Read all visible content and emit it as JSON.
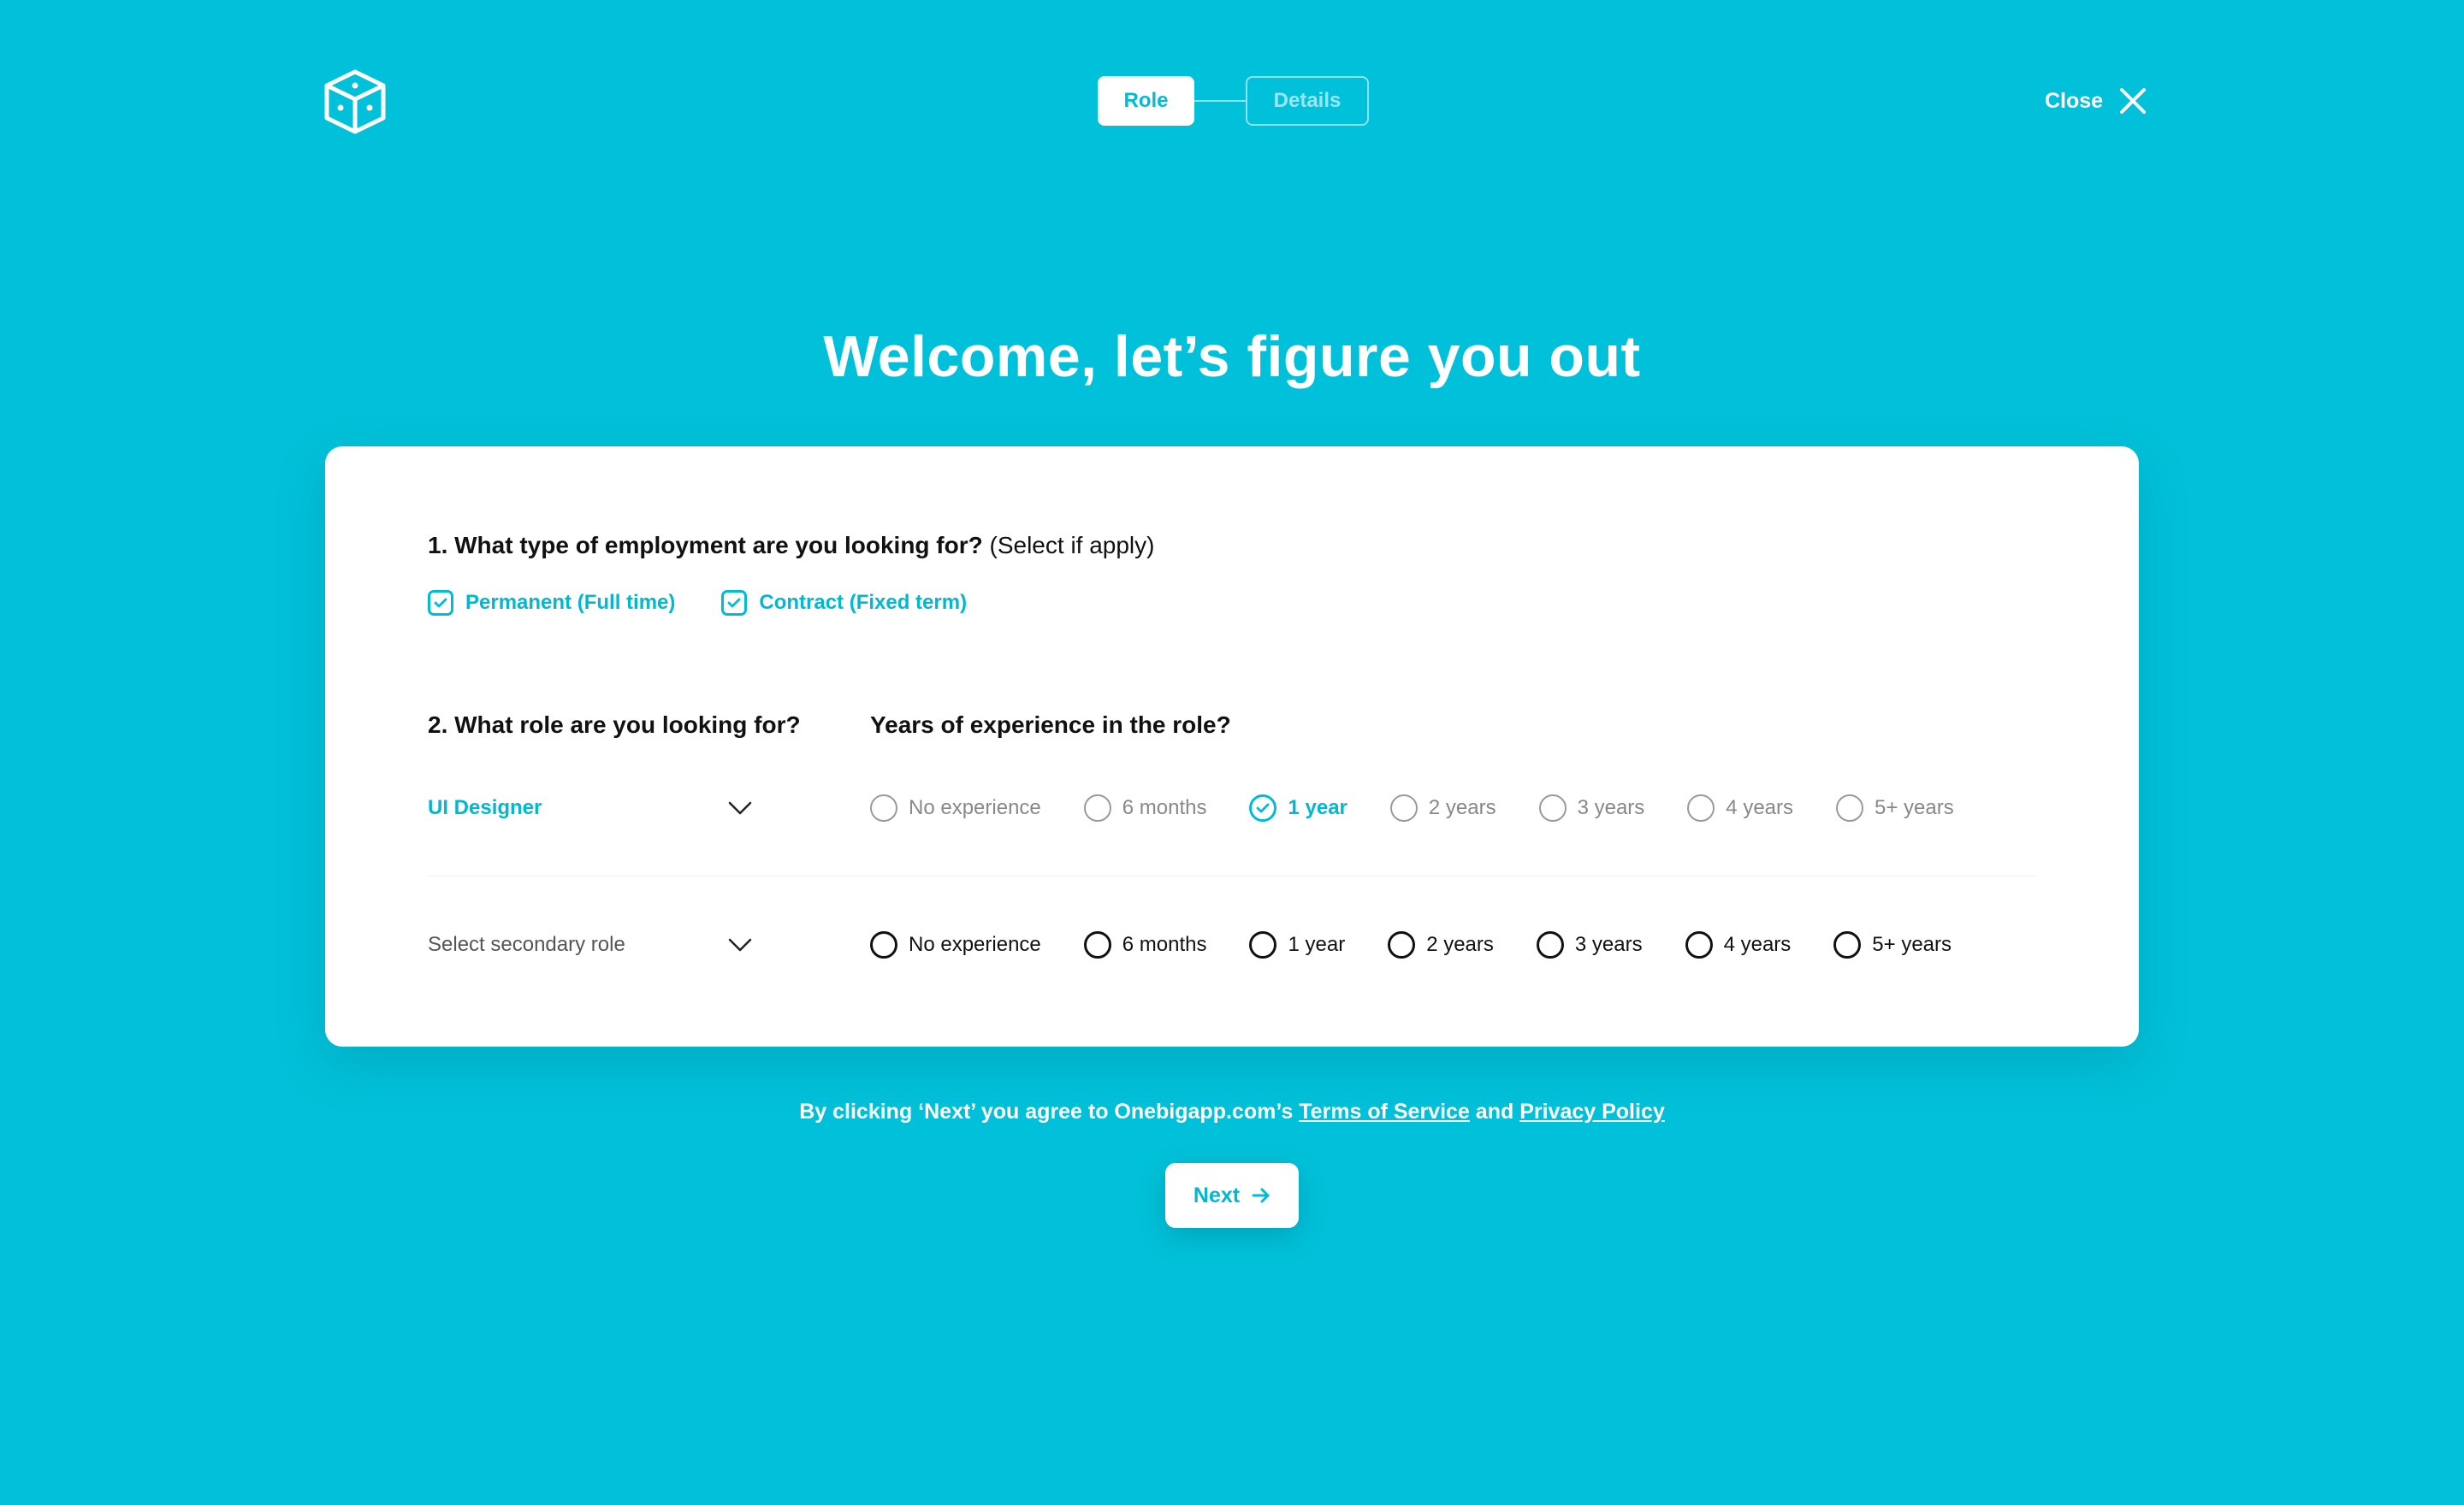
{
  "header": {
    "steps": [
      {
        "label": "Role",
        "active": true
      },
      {
        "label": "Details",
        "active": false
      }
    ],
    "close_label": "Close"
  },
  "headline": "Welcome, let’s figure you out",
  "form": {
    "q1": {
      "title": "1. What type of employment are you looking for?",
      "hint": "(Select if apply)",
      "options": [
        {
          "label": "Permanent (Full time)",
          "checked": true
        },
        {
          "label": "Contract (Fixed term)",
          "checked": true
        }
      ]
    },
    "q2": {
      "title": "2. What role are you looking for?",
      "primary_role": "UI Designer",
      "secondary_role_placeholder": "Select secondary role"
    },
    "q3": {
      "title": "Years of experience in the role?",
      "options": [
        "No experience",
        "6 months",
        "1 year",
        "2 years",
        "3 years",
        "4 years",
        "5+ years"
      ],
      "primary_selected": "1 year",
      "secondary_selected": null
    }
  },
  "footer": {
    "terms_prefix": "By clicking ‘Next’ you agree to Onebigapp.com’s",
    "terms_link": "Terms of Service",
    "terms_and": "and",
    "privacy_link": "Privacy Policy",
    "next_label": "Next"
  },
  "colors": {
    "background": "#00C1D9",
    "accent": "#00BCD4",
    "card": "#FFFFFF"
  },
  "icons": {
    "logo": "cube-icon",
    "close": "close-icon",
    "dropdown": "chevron-down-icon",
    "check": "check-icon",
    "next": "arrow-right-icon"
  }
}
